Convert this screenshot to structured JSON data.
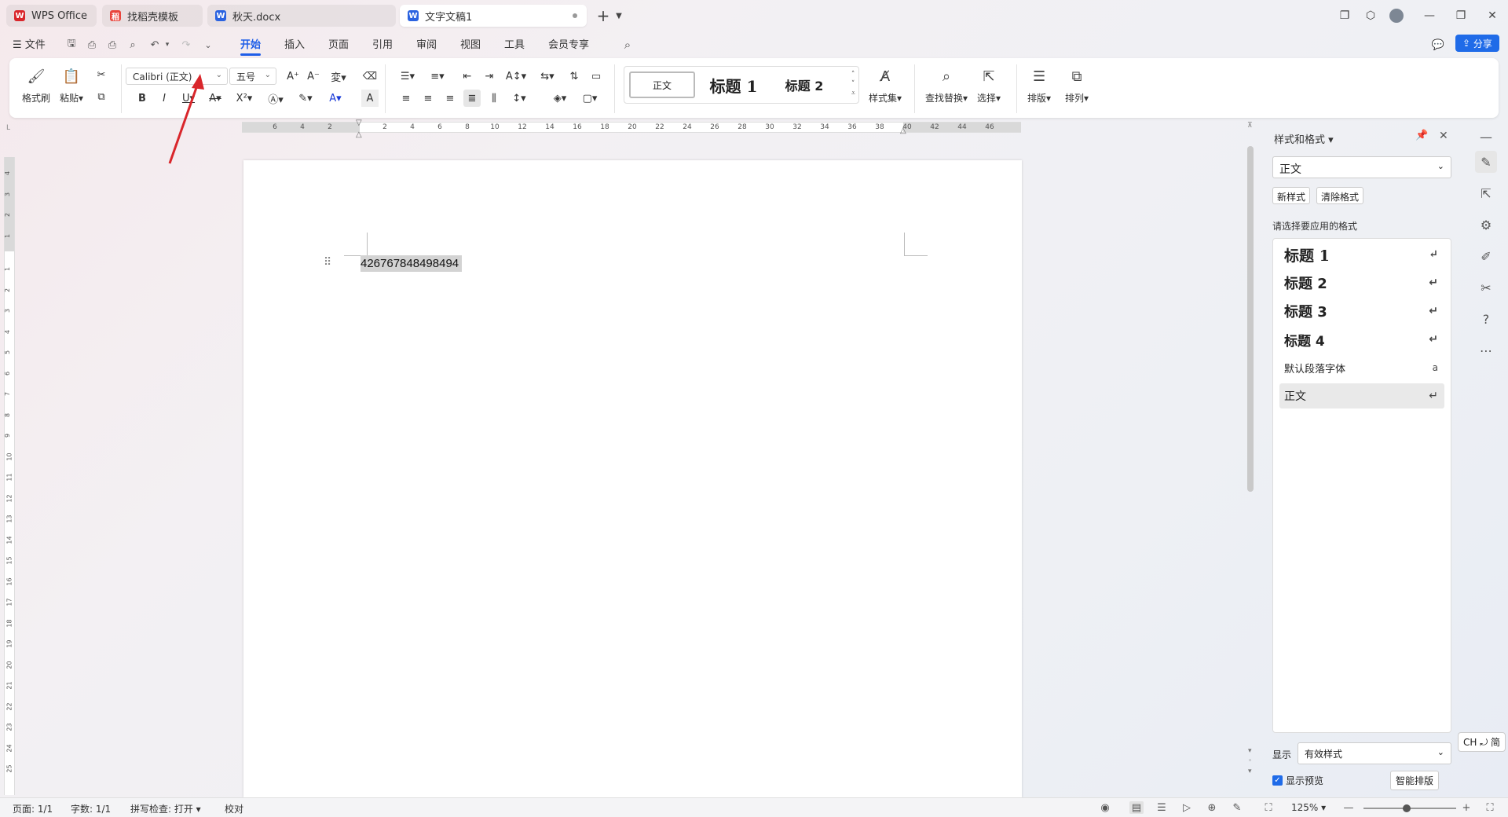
{
  "tabs": [
    {
      "label": "WPS Office",
      "icon": "wps-logo-icon"
    },
    {
      "label": "找稻壳模板",
      "icon": "docer-icon"
    },
    {
      "label": "秋天.docx",
      "icon": "word-doc-icon"
    },
    {
      "label": "文字文稿1",
      "icon": "word-doc-icon"
    }
  ],
  "menu": {
    "file": "文件",
    "items": [
      "开始",
      "插入",
      "页面",
      "引用",
      "审阅",
      "视图",
      "工具",
      "会员专享"
    ],
    "share": "分享"
  },
  "ribbon": {
    "format_painter": "格式刷",
    "paste": "粘贴",
    "font_name": "Calibri (正文)",
    "font_size": "五号",
    "styles": [
      "正文",
      "标题 1",
      "标题 2"
    ],
    "style_set": "样式集",
    "find_replace": "查找替换",
    "select": "选择",
    "layout": "排版",
    "arrange": "排列"
  },
  "ruler": {
    "h_numbers": [
      "6",
      "4",
      "2",
      "2",
      "4",
      "6",
      "8",
      "10",
      "12",
      "14",
      "16",
      "18",
      "20",
      "22",
      "24",
      "26",
      "28",
      "30",
      "32",
      "34",
      "36",
      "38",
      "40",
      "42",
      "44",
      "46"
    ],
    "v_numbers": [
      "4",
      "3",
      "2",
      "1",
      "1",
      "2",
      "3",
      "4",
      "5",
      "6",
      "7",
      "8",
      "9",
      "10",
      "11",
      "12",
      "13",
      "14",
      "15",
      "16",
      "17",
      "18",
      "19",
      "20",
      "21",
      "22",
      "23",
      "24",
      "25"
    ]
  },
  "document": {
    "text": "426767848498494"
  },
  "panel": {
    "title": "样式和格式",
    "current_style": "正文",
    "new_style": "新样式",
    "clear_format": "清除格式",
    "hint": "请选择要应用的格式",
    "styles": [
      "标题 1",
      "标题 2",
      "标题 3",
      "标题 4",
      "默认段落字体",
      "正文"
    ],
    "show_label": "显示",
    "show_value": "有效样式",
    "preview_label": "显示预览",
    "smart_layout": "智能排版"
  },
  "ime": "CH ⤾ 简",
  "status": {
    "page": "页面: 1/1",
    "words": "字数: 1/1",
    "spell": "拼写检查: 打开",
    "proof": "校对",
    "zoom": "125%"
  },
  "colors": {
    "accent": "#1f5ee8",
    "annotation_arrow": "#d9262b"
  }
}
